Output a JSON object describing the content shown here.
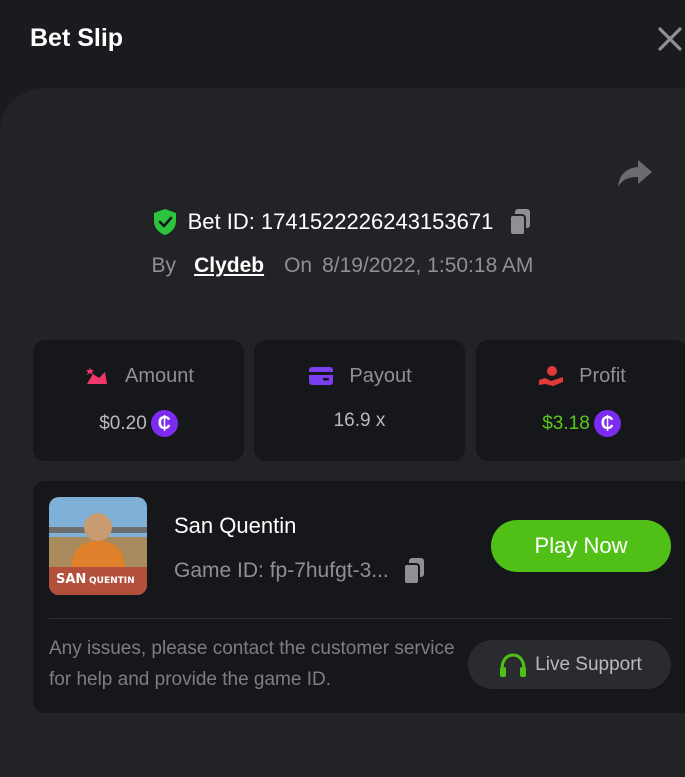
{
  "header": {
    "title": "Bet Slip"
  },
  "bet": {
    "id_label": "Bet ID:",
    "id_value": "1741522226243153671",
    "by_label": "By",
    "username": "Clydeb",
    "on_label": "On",
    "datetime": "8/19/2022, 1:50:18 AM"
  },
  "stats": {
    "amount": {
      "label": "Amount",
      "value": "$0.20",
      "coin": "₵"
    },
    "payout": {
      "label": "Payout",
      "value": "16.9 x"
    },
    "profit": {
      "label": "Profit",
      "value": "$3.18",
      "coin": "₵"
    }
  },
  "game": {
    "name": "San Quentin",
    "id_text": "Game ID: fp-7hufgt-3...",
    "thumb_caption_a": "SAN",
    "thumb_caption_b": "QUENTIN",
    "play_label": "Play Now",
    "help_text": "Any issues, please contact the customer service for help and provide the game ID.",
    "support_label": "Live Support"
  },
  "colors": {
    "accent_green": "#51c016",
    "profit_green": "#58c91a",
    "coin_purple": "#7b2cf0",
    "shield_green": "#2bc43c",
    "amount_pink": "#f0386b",
    "payout_purple": "#7b3ff2",
    "profit_red": "#e03a3a"
  }
}
